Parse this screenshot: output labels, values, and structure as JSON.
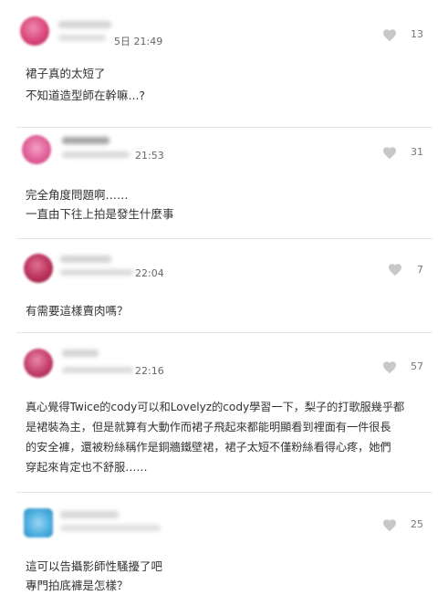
{
  "comments": [
    {
      "time": "5日 21:49",
      "likes": "13",
      "avatar_color": "#d9467a",
      "lines": [
        "裙子真的太短了",
        "不知道造型師在幹嘛...?"
      ]
    },
    {
      "time": "21:53",
      "likes": "31",
      "avatar_color": "#e0609a",
      "lines": [
        "完全角度問題啊……",
        "一直由下往上拍是發生什麼事"
      ]
    },
    {
      "time": "22:04",
      "likes": "7",
      "avatar_color": "#b8305a",
      "lines": [
        "有需要這樣賣肉嗎？"
      ]
    },
    {
      "time": "22:16",
      "likes": "57",
      "avatar_color": "#c23c6a",
      "lines": [
        "真心覺得Twice的cody可以和Lovelyz的cody學習一下，梨子的打歌服幾乎都",
        "是裙裝為主，但是就算有大動作而裙子飛起來都能明顯看到裡面有一件很長",
        "的安全褲，還被粉絲稱作是銅牆鐵壁裙，裙子太短不僅粉絲看得心疼，她們",
        "穿起來肯定也不舒服……"
      ]
    },
    {
      "time": "",
      "likes": "25",
      "avatar_color": "#4fb0e0",
      "lines": [
        "這可以告攝影師性騷擾了吧",
        "專門拍底褲是怎樣？"
      ]
    }
  ],
  "icons": {
    "like": "heart-icon"
  },
  "colors": {
    "heart": "#c8c8c8",
    "divider": "#e4e4e4",
    "text": "#333333"
  }
}
